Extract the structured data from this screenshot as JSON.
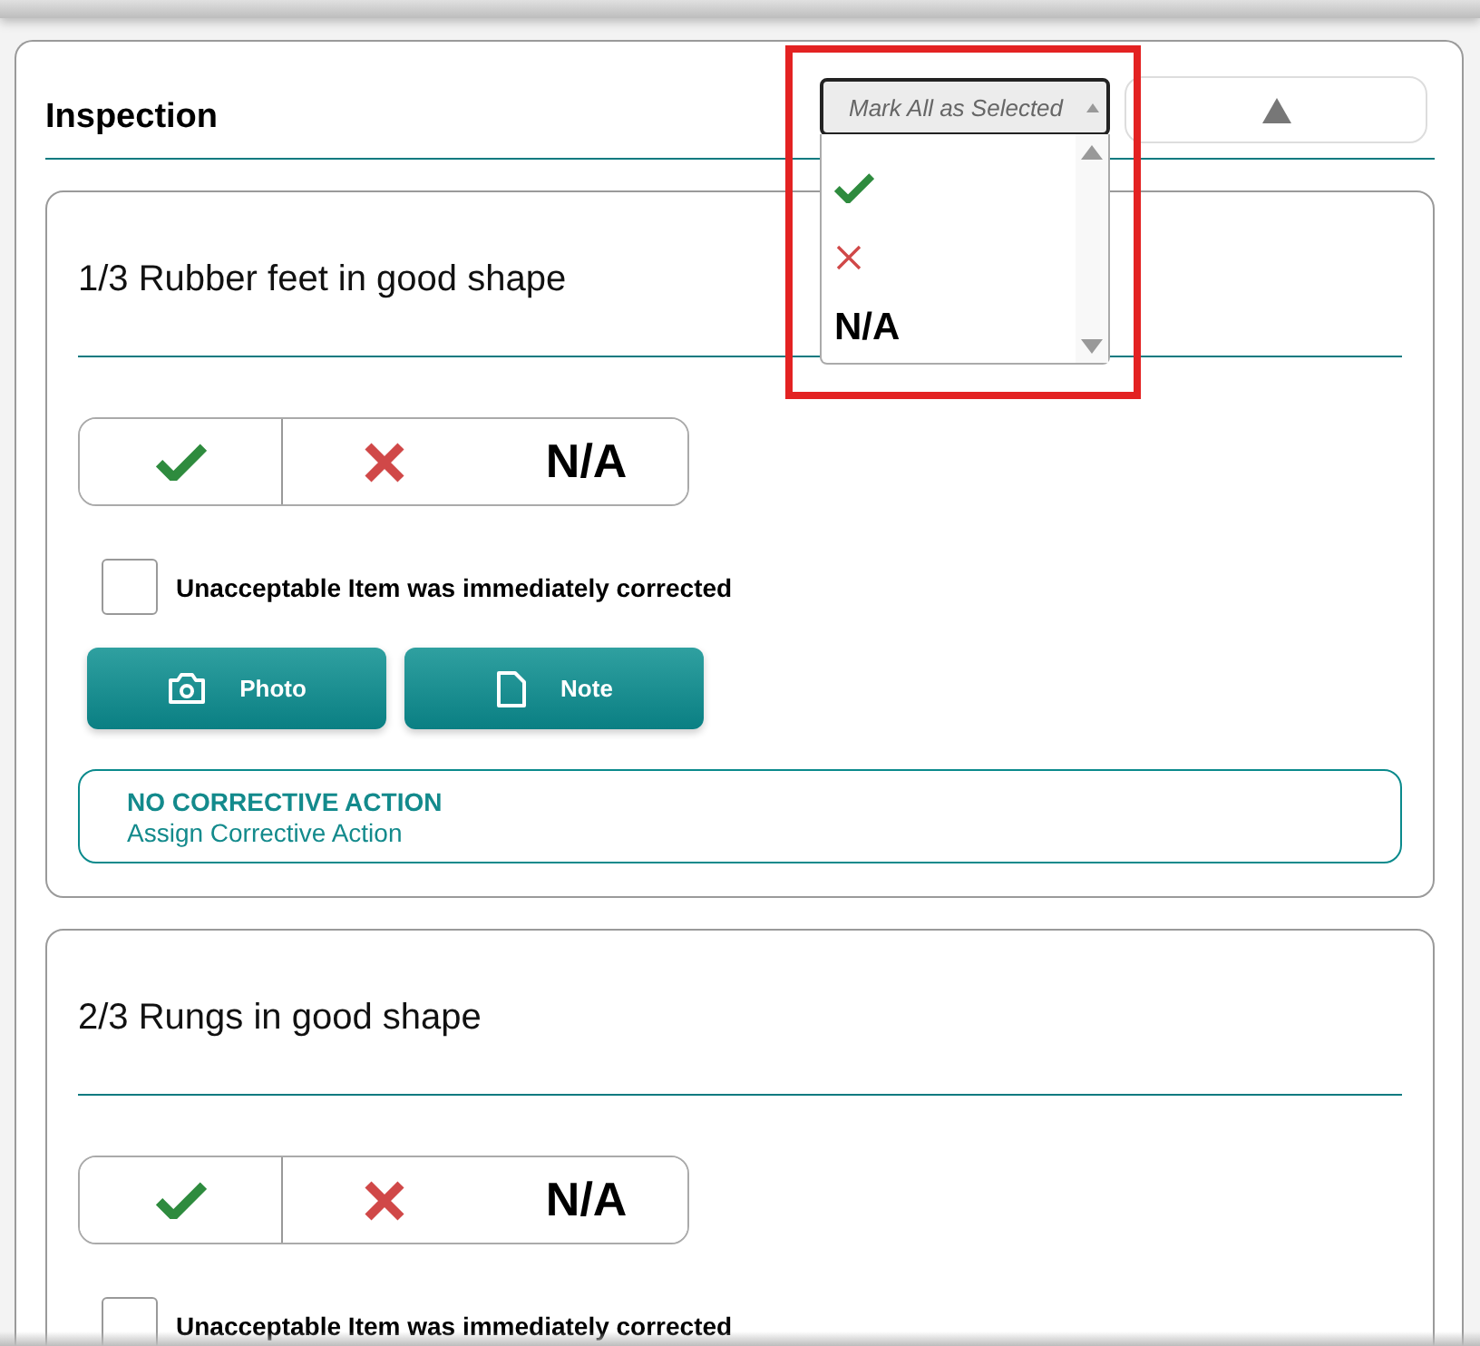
{
  "header": {
    "title": "Inspection",
    "mark_all": {
      "label": "Mark All as Selected",
      "expanded": true,
      "options": [
        {
          "kind": "check"
        },
        {
          "kind": "cross"
        },
        {
          "kind": "text",
          "label": "N/A"
        }
      ]
    }
  },
  "items": [
    {
      "title": "1/3 Rubber feet in good shape",
      "choices": [
        {
          "kind": "check"
        },
        {
          "kind": "cross"
        },
        {
          "kind": "text",
          "label": "N/A"
        }
      ],
      "corrected": {
        "label": "Unacceptable Item was immediately corrected",
        "checked": false
      },
      "buttons": [
        {
          "kind": "photo",
          "label": "Photo"
        },
        {
          "kind": "note",
          "label": "Note"
        }
      ],
      "corrective_action": {
        "status": "NO CORRECTIVE ACTION",
        "link": "Assign Corrective Action"
      }
    },
    {
      "title": "2/3 Rungs in good shape",
      "choices": [
        {
          "kind": "check"
        },
        {
          "kind": "cross"
        },
        {
          "kind": "text",
          "label": "N/A"
        }
      ],
      "corrected": {
        "label": "Unacceptable Item was immediately corrected",
        "checked": false
      }
    }
  ]
}
